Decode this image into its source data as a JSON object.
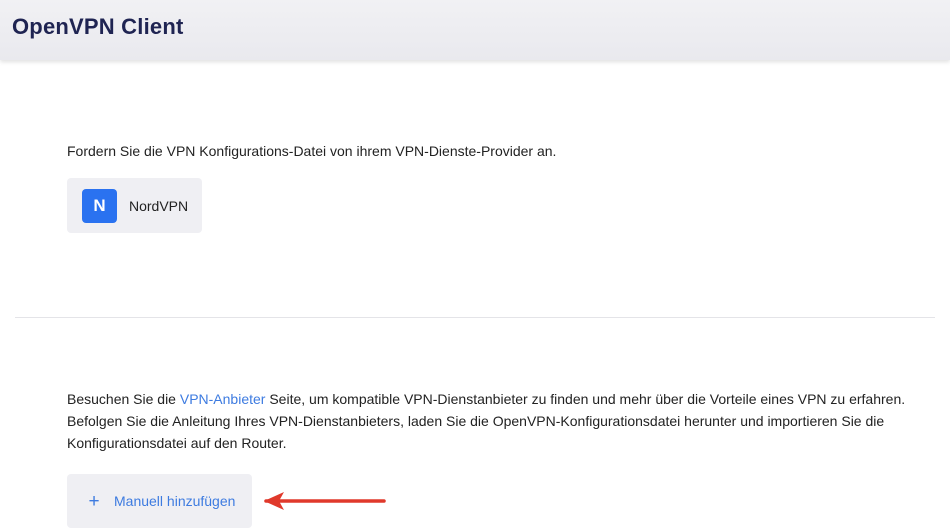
{
  "header": {
    "title": "OpenVPN Client"
  },
  "instruction": "Fordern Sie die VPN Konfigurations-Datei von ihrem VPN-Dienste-Provider an.",
  "provider": {
    "logo_letter": "N",
    "name": "NordVPN",
    "logo_color": "#2a72f0"
  },
  "info": {
    "prefix": "Besuchen Sie die ",
    "link": "VPN-Anbieter",
    "line1_rest": " Seite, um kompatible VPN-Dienstanbieter zu finden und mehr über die Vorteile eines VPN zu erfahren.",
    "line2": "Befolgen Sie die Anleitung Ihres VPN-Dienstanbieters, laden Sie die OpenVPN-Konfigurationsdatei herunter und importieren Sie die Konfigurationsdatei auf den Router."
  },
  "add_button": {
    "icon": "plus-icon",
    "label": "Manuell hinzufügen"
  },
  "colors": {
    "accent": "#3d7be0",
    "title": "#1f2452",
    "arrow": "#e0392b"
  }
}
